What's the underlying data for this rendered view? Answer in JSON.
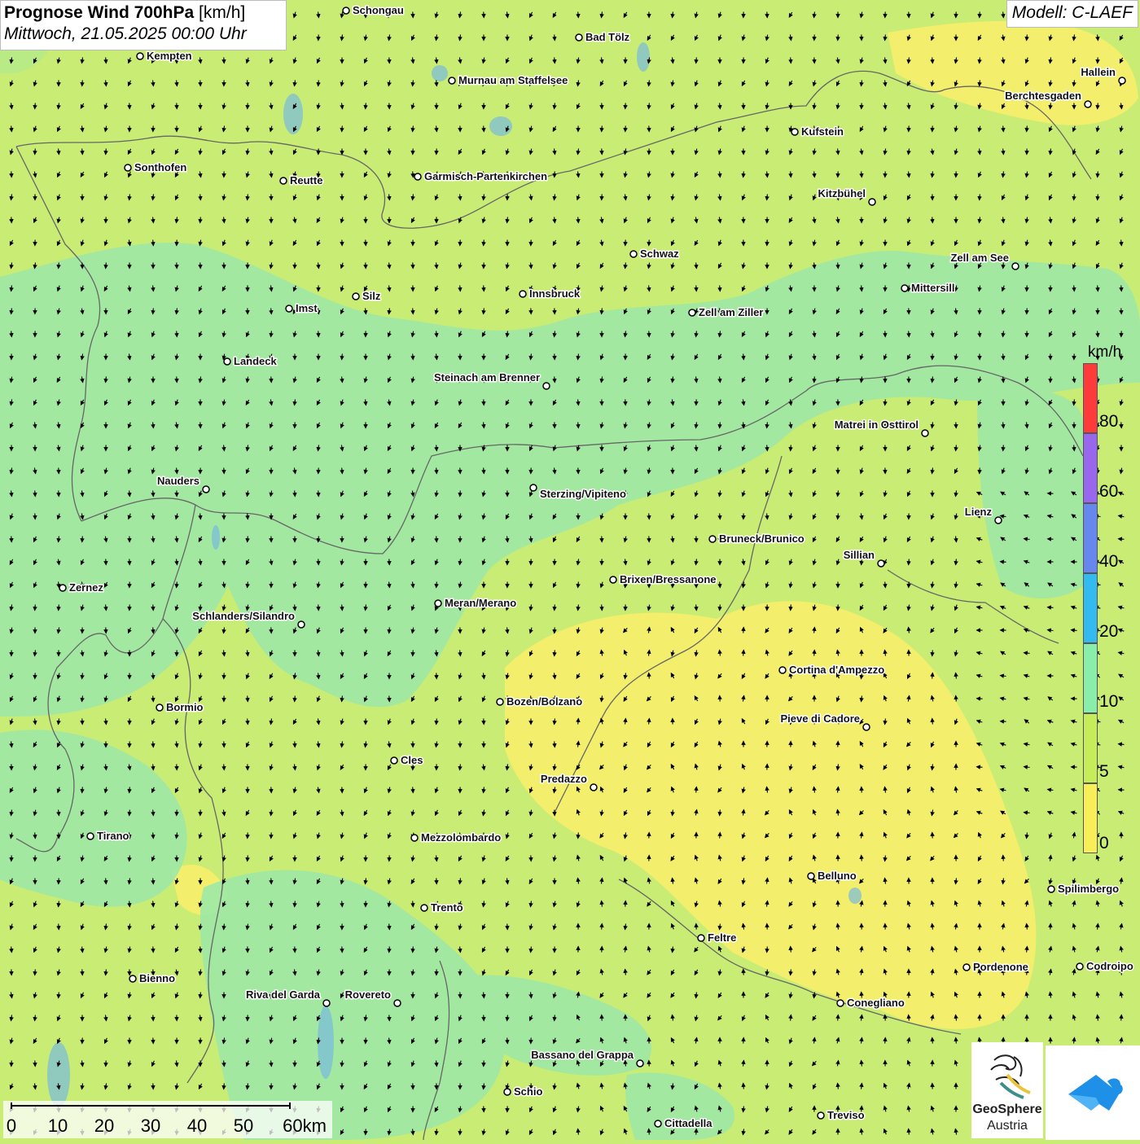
{
  "header": {
    "title": "Prognose Wind 700hPa",
    "title_unit": "[km/h]",
    "datetime": "Mittwoch, 21.05.2025 00:00 Uhr"
  },
  "model_label": "Modell: C-LAEF",
  "legend": {
    "unit": "km/h",
    "ticks": [
      "80",
      "60",
      "40",
      "20",
      "10",
      "5",
      "0"
    ],
    "colors": [
      "#ff3a3a",
      "#9966ee",
      "#6688ee",
      "#33bbf0",
      "#88eeaa",
      "#c6ec5a",
      "#f8ee58"
    ]
  },
  "scale_bar": {
    "labels": [
      "0",
      "10",
      "20",
      "30",
      "40",
      "50",
      "60km"
    ]
  },
  "logo": {
    "name": "GeoSphere",
    "sub": "Austria"
  },
  "colors": {
    "calm_yellow": "#f6ee6a",
    "light_green": "#c8ec74",
    "mint": "#9ee8a6",
    "border_line": "#666666"
  },
  "cities": [
    "Schongau",
    "Bad Tölz",
    "Kempten",
    "Murnau am Staffelsee",
    "Hallein",
    "Berchtesgaden",
    "Kufstein",
    "Sonthofen",
    "Reutte",
    "Garmisch-Partenkirchen",
    "Kitzbühel",
    "Schwaz",
    "Zell am See",
    "Innsbruck",
    "Mittersill",
    "Silz",
    "Imst",
    "Zell am Ziller",
    "Landeck",
    "Steinach am Brenner",
    "Matrei in Osttirol",
    "Nauders",
    "Sterzing/Vipiteno",
    "Lienz",
    "Bruneck/Brunico",
    "Sillian",
    "Zernez",
    "Brixen/Bressanone",
    "Meran/Merano",
    "Schlanders/Silandro",
    "Cortina d'Ampezzo",
    "Bozen/Bolzano",
    "Bormio",
    "Pieve di Cadore",
    "Cles",
    "Predazzo",
    "Tirano",
    "Mezzolombardo",
    "Belluno",
    "Spilimbergo",
    "Trento",
    "Feltre",
    "Pordenone",
    "Codroipo",
    "Bienno",
    "Riva del Garda",
    "Rovereto",
    "Conegliano",
    "Bassano del Grappa",
    "Schio",
    "Treviso",
    "Cittadella"
  ]
}
